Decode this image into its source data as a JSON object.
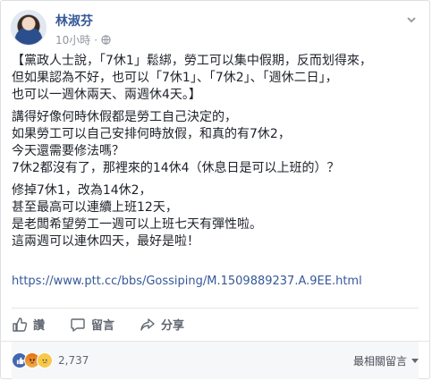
{
  "post": {
    "author": "林淑芬",
    "time": "10小時",
    "paragraphs": [
      "【黨政人士說，「7休1」鬆綁，勞工可以集中假期，反而划得來，\n但如果認為不好，也可以「7休1」、「7休2」、「週休二日」，\n也可以一週休兩天、兩週休4天。】",
      "講得好像何時休假都是勞工自己決定的，\n如果勞工可以自己安排何時放假，和真的有7休2，\n今天還需要修法嗎？\n7休2都沒有了，那裡來的14休4（休息日是可以上班的）？",
      "修掉7休1，改為14休2，\n甚至最高可以連續上班12天，\n是老闆希望勞工一週可以上班七天有彈性啦。\n這兩週可以連休四天，最好是啦！"
    ],
    "link": "https://www.ptt.cc/bbs/Gossiping/M.1509889237.A.9EE.html"
  },
  "actions": {
    "like": "讚",
    "comment": "留言",
    "share": "分享"
  },
  "footer": {
    "reaction_count": "2,737",
    "sort_label": "最相關留言"
  },
  "icons": {
    "privacy": "globe-icon",
    "menu": "chevron-down-icon",
    "like": "thumbs-up-icon",
    "comment": "comment-icon",
    "share": "share-icon"
  },
  "colors": {
    "link": "#365899",
    "like_reaction": "#4267b2",
    "angry_reaction": "#e9710f",
    "sad_reaction": "#f7c94b"
  }
}
